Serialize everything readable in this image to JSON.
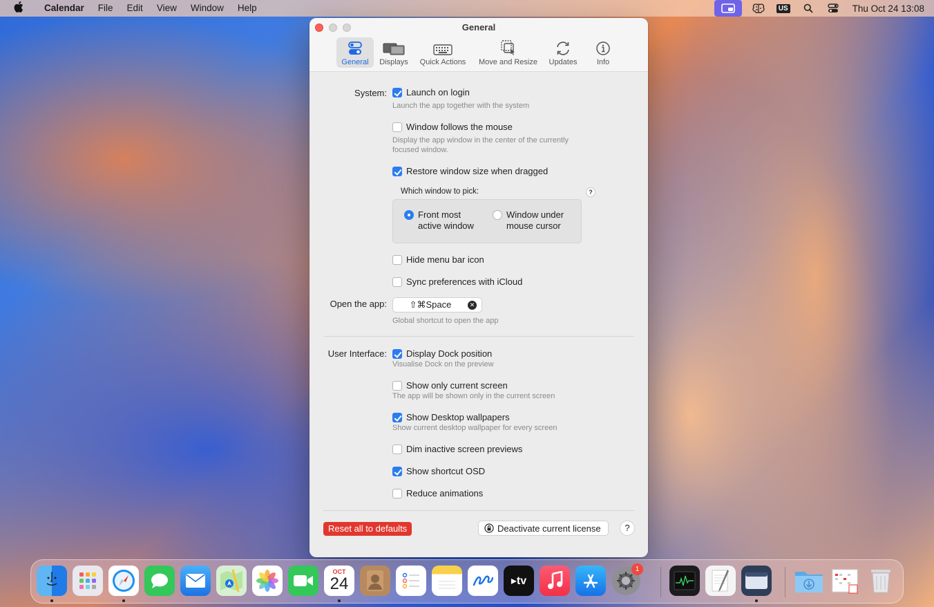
{
  "menubar": {
    "app_name": "Calendar",
    "items": [
      "File",
      "Edit",
      "View",
      "Window",
      "Help"
    ],
    "keyboard_layout": "US",
    "clock": "Thu Oct 24  13:08"
  },
  "window": {
    "title": "General",
    "tabs": [
      {
        "label": "General",
        "icon": "toggles-icon",
        "active": true
      },
      {
        "label": "Displays",
        "icon": "displays-icon",
        "active": false
      },
      {
        "label": "Quick Actions",
        "icon": "keyboard-icon",
        "active": false
      },
      {
        "label": "Move and Resize",
        "icon": "move-resize-icon",
        "active": false
      },
      {
        "label": "Updates",
        "icon": "refresh-icon",
        "active": false
      },
      {
        "label": "Info",
        "icon": "info-icon",
        "active": false
      }
    ]
  },
  "system": {
    "section_label": "System:",
    "launch_on_login": {
      "label": "Launch on login",
      "checked": true,
      "desc": "Launch the app together with the system"
    },
    "window_follows_mouse": {
      "label": "Window follows the mouse",
      "checked": false,
      "desc_line1": "Display the app window in the center of the currently",
      "desc_line2": "focused window."
    },
    "restore_window_size": {
      "label": "Restore window size when dragged",
      "checked": true
    },
    "which_window": {
      "label": "Which window to pick:",
      "help": "?",
      "options": [
        {
          "line1": "Front most",
          "line2": "active window",
          "selected": true
        },
        {
          "line1": "Window under",
          "line2": "mouse cursor",
          "selected": false
        }
      ]
    },
    "hide_menu_bar_icon": {
      "label": "Hide menu bar icon",
      "checked": false
    },
    "sync_icloud": {
      "label": "Sync preferences with iCloud",
      "checked": false
    }
  },
  "open_app": {
    "label": "Open the app:",
    "shortcut": "⇧⌘Space",
    "desc": "Global shortcut to open the app"
  },
  "user_interface": {
    "section_label": "User Interface:",
    "display_dock": {
      "label": "Display Dock position",
      "checked": true,
      "desc": "Visualise Dock on the preview"
    },
    "only_current_screen": {
      "label": "Show only current screen",
      "checked": false,
      "desc": "The app will be shown only in the current screen"
    },
    "desktop_wallpapers": {
      "label": "Show Desktop wallpapers",
      "checked": true,
      "desc": "Show current desktop wallpaper for every screen"
    },
    "dim_inactive": {
      "label": "Dim inactive screen previews",
      "checked": false
    },
    "shortcut_osd": {
      "label": "Show shortcut OSD",
      "checked": true
    },
    "reduce_animations": {
      "label": "Reduce animations",
      "checked": false
    }
  },
  "footer": {
    "reset_label": "Reset all to defaults",
    "deactivate_label": "Deactivate current license",
    "help": "?"
  },
  "dock": {
    "calendar_month": "OCT",
    "calendar_day": "24",
    "settings_badge": "1",
    "apps": [
      "Finder",
      "Launchpad",
      "Safari",
      "Messages",
      "Mail",
      "Maps",
      "Photos",
      "FaceTime",
      "Calendar",
      "Contacts",
      "Reminders",
      "Notes",
      "Freeform",
      "TV",
      "Music",
      "App Store",
      "System Settings",
      "Activity Monitor",
      "TextEdit",
      "Preview App",
      "Downloads",
      "Calendar Stack",
      "Trash"
    ]
  },
  "colors": {
    "accent": "#2b7cf0",
    "reset_button": "#e1372e",
    "menubar_active": "#6f63e8"
  }
}
